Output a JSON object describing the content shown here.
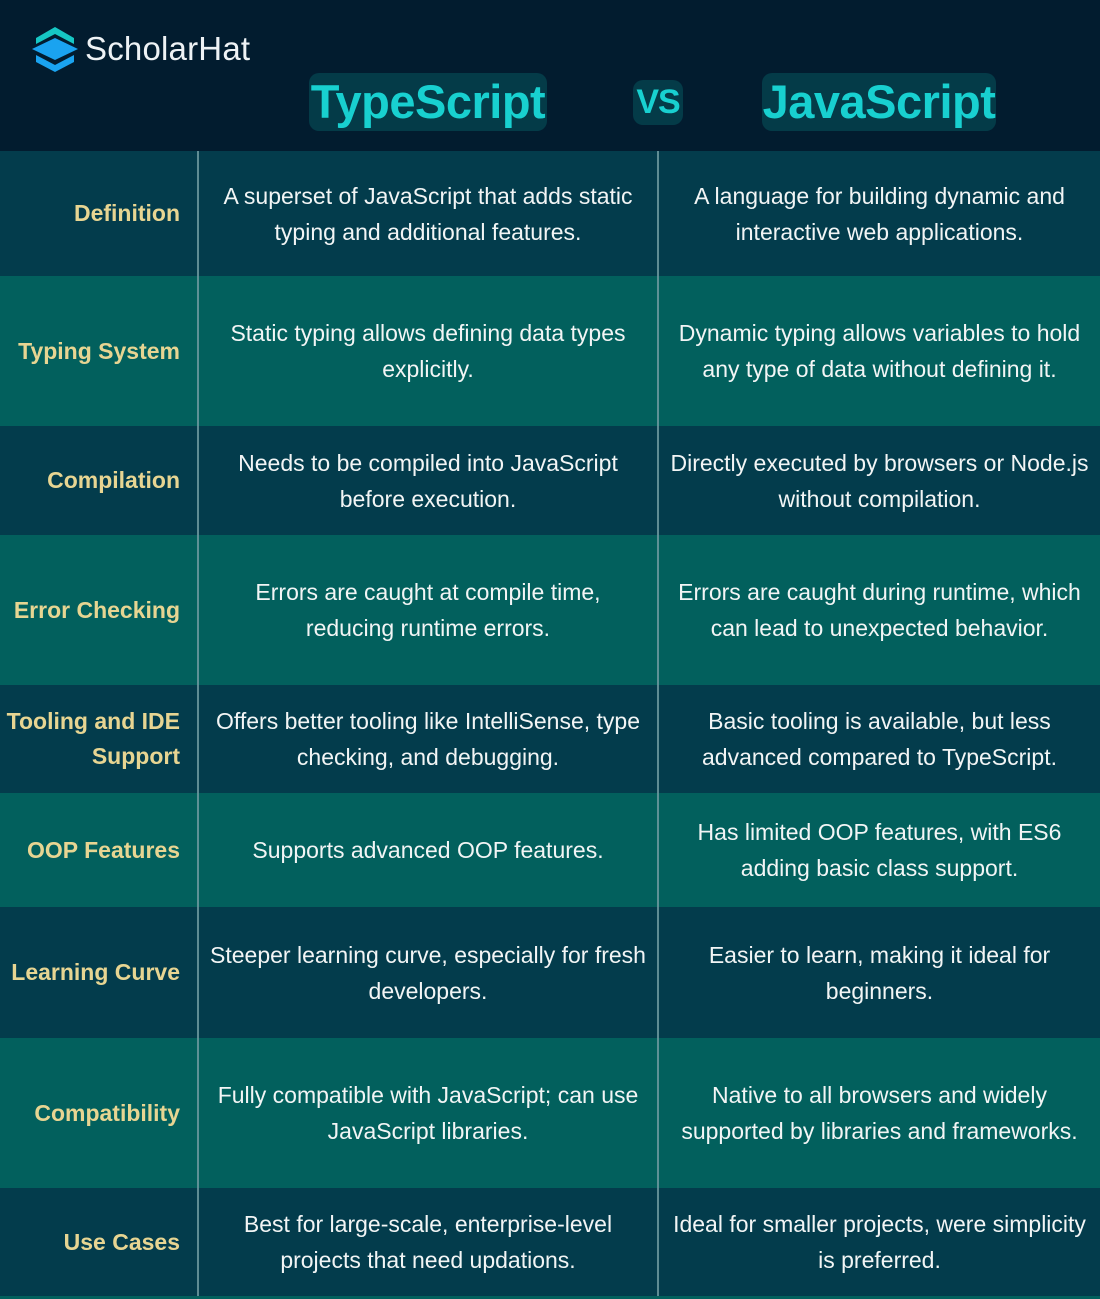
{
  "brand": {
    "name": "ScholarHat",
    "icon": "graduation-cap-stack-icon",
    "colors": {
      "top": "#16c7c4",
      "middle": "#1aa3f0",
      "bottom": "#1aa3f0"
    }
  },
  "header": {
    "left_title": "TypeScript",
    "vs": "VS",
    "right_title": "JavaScript"
  },
  "colors": {
    "background": "#021c2f",
    "row_dark": "#033c4c",
    "row_teal": "#02605d",
    "label": "#e7d592",
    "title": "#18d0d0",
    "text": "#f2f5f5"
  },
  "rows": [
    {
      "label": "Definition",
      "typescript": "A superset of JavaScript that adds static typing and additional features.",
      "javascript": "A language for building dynamic and interactive web applications."
    },
    {
      "label": "Typing System",
      "typescript": "Static typing allows defining data types explicitly.",
      "javascript": "Dynamic typing allows variables to hold any type of data without defining it."
    },
    {
      "label": "Compilation",
      "typescript": "Needs to be compiled into JavaScript before execution.",
      "javascript": "Directly executed by browsers or Node.js without compilation."
    },
    {
      "label": "Error Checking",
      "typescript": "Errors are caught at compile time, reducing runtime errors.",
      "javascript": "Errors are caught during runtime, which can lead to unexpected behavior."
    },
    {
      "label": "Tooling and IDE Support",
      "typescript": "Offers better tooling like IntelliSense, type checking, and debugging.",
      "javascript": "Basic tooling is available, but less advanced compared to TypeScript."
    },
    {
      "label": "OOP Features",
      "typescript": "Supports advanced OOP features.",
      "javascript": "Has limited OOP features, with ES6 adding basic class support."
    },
    {
      "label": "Learning Curve",
      "typescript": "Steeper learning curve, especially for fresh developers.",
      "javascript": "Easier to learn, making it ideal for beginners."
    },
    {
      "label": "Compatibility",
      "typescript": "Fully compatible with JavaScript; can use JavaScript libraries.",
      "javascript": "Native to all browsers and widely supported by libraries and frameworks."
    },
    {
      "label": "Use Cases",
      "typescript": "Best for large-scale, enterprise-level projects that need updations.",
      "javascript": "Ideal for smaller projects, were simplicity is preferred."
    }
  ]
}
